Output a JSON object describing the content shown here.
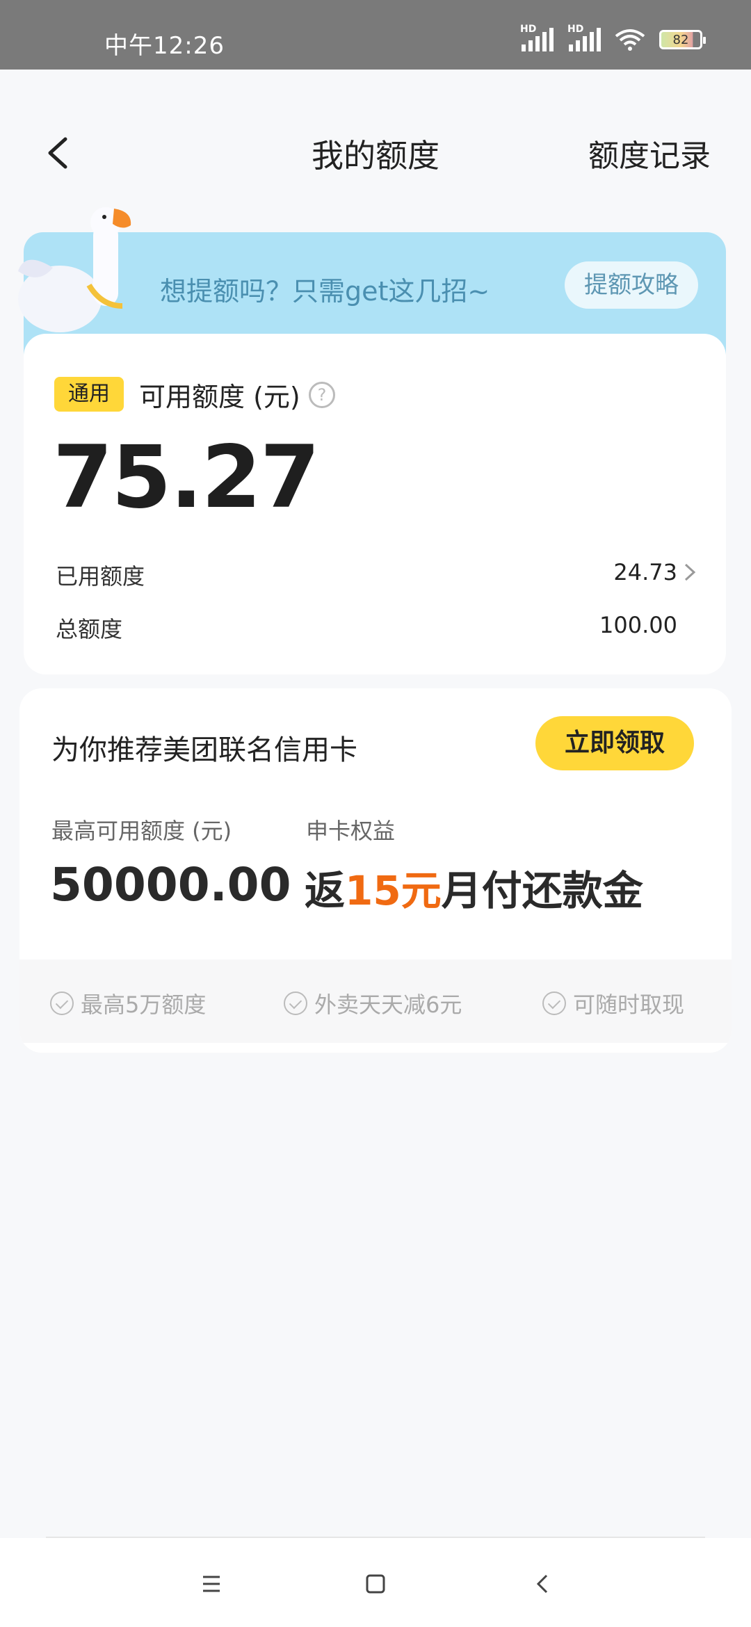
{
  "status_bar": {
    "time": "中午12:26",
    "network1": "HD",
    "network2": "HD",
    "battery": "82"
  },
  "nav": {
    "title": "我的额度",
    "right_link": "额度记录"
  },
  "banner": {
    "text": "想提额吗？只需get这几招~",
    "button": "提额攻略"
  },
  "credit": {
    "tag": "通用",
    "available_label": "可用额度 (元)",
    "available_value": "75.27",
    "used_label": "已用额度",
    "used_value": "24.73",
    "total_label": "总额度",
    "total_value": "100.00"
  },
  "promo": {
    "title": "为你推荐美团联名信用卡",
    "button": "立即领取",
    "max_limit_label": "最高可用额度 (元)",
    "max_limit_value": "50000.00",
    "benefit_label": "申卡权益",
    "benefit_prefix": "返",
    "benefit_highlight": "15元",
    "benefit_suffix": "月付还款金",
    "features": [
      "最高5万额度",
      "外卖天天减6元",
      "可随时取现"
    ]
  },
  "colors": {
    "accent_yellow": "#ffd739",
    "accent_orange": "#f06a12",
    "banner_blue": "#aee2f6"
  }
}
